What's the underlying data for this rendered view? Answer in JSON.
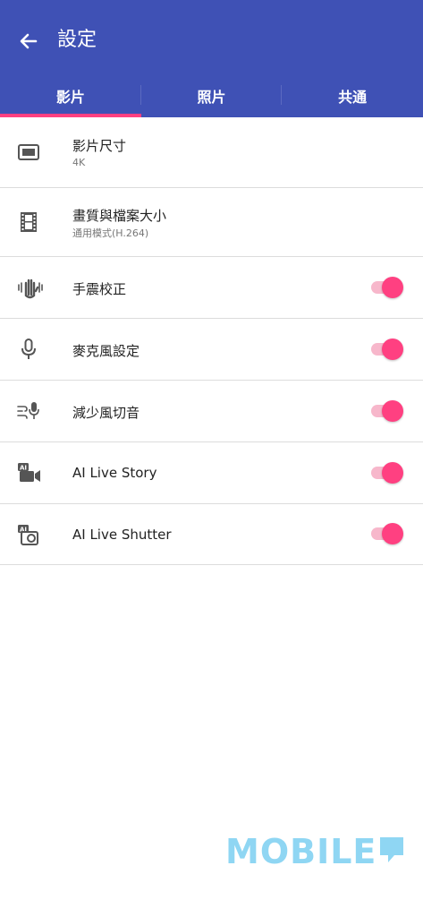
{
  "header": {
    "title": "設定"
  },
  "tabs": [
    {
      "label": "影片",
      "active": true
    },
    {
      "label": "照片",
      "active": false
    },
    {
      "label": "共通",
      "active": false
    }
  ],
  "settings": [
    {
      "label": "影片尺寸",
      "value": "4K",
      "icon": "video-size-icon"
    },
    {
      "label": "畫質與檔案大小",
      "value": "通用模式(H.264)",
      "icon": "film-strip-icon"
    },
    {
      "label": "手震校正",
      "icon": "hand-stabilization-icon",
      "toggle": true
    },
    {
      "label": "麥克風設定",
      "icon": "microphone-icon",
      "toggle": true
    },
    {
      "label": "減少風切音",
      "icon": "wind-noise-mic-icon",
      "toggle": true
    },
    {
      "label": "AI Live Story",
      "icon": "ai-video-icon",
      "toggle": true
    },
    {
      "label": "AI Live Shutter",
      "icon": "ai-shutter-icon",
      "toggle": true
    }
  ],
  "watermark": {
    "text": "MOBILE"
  },
  "colors": {
    "header": "#3f51b5",
    "accent": "#ff4081",
    "track": "#f7b7cb"
  }
}
